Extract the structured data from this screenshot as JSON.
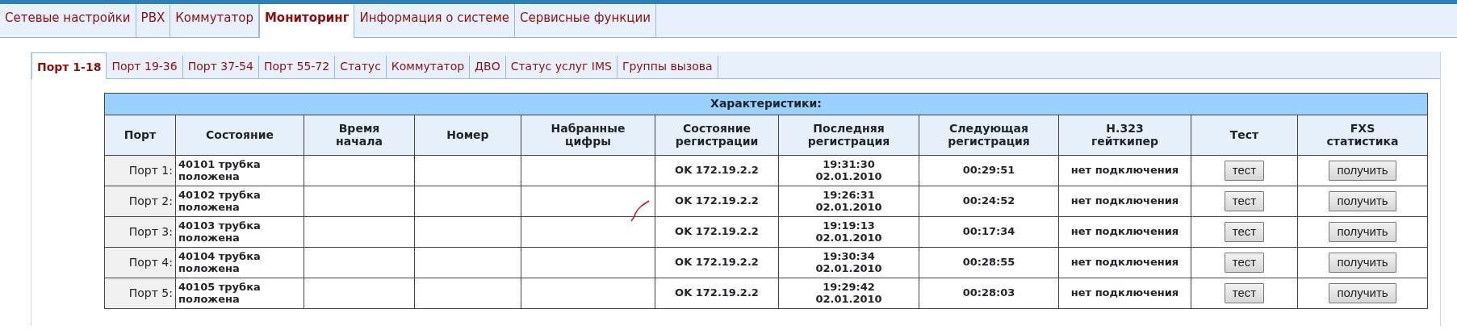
{
  "top_tabs": [
    {
      "label": "Сетевые настройки",
      "selected": false
    },
    {
      "label": "PBX",
      "selected": false
    },
    {
      "label": "Коммутатор",
      "selected": false
    },
    {
      "label": "Мониторинг",
      "selected": true
    },
    {
      "label": "Информация о системе",
      "selected": false
    },
    {
      "label": "Сервисные функции",
      "selected": false
    }
  ],
  "sub_tabs": [
    {
      "label": "Порт 1-18",
      "selected": true
    },
    {
      "label": "Порт 19-36",
      "selected": false
    },
    {
      "label": "Порт 37-54",
      "selected": false
    },
    {
      "label": "Порт 55-72",
      "selected": false
    },
    {
      "label": "Статус",
      "selected": false
    },
    {
      "label": "Коммутатор",
      "selected": false
    },
    {
      "label": "ДВО",
      "selected": false
    },
    {
      "label": "Статус услуг IMS",
      "selected": false
    },
    {
      "label": "Группы вызова",
      "selected": false
    }
  ],
  "table": {
    "title": "Характеристики:",
    "columns": [
      "Порт",
      "Состояние",
      "Время\nначала",
      "Номер",
      "Набранные\nцифры",
      "Состояние\nрегистрации",
      "Последняя\nрегистрация",
      "Следующая\nрегистрация",
      "H.323\nгейткипер",
      "Тест",
      "FXS\nстатистика"
    ],
    "rows": [
      {
        "port": "Порт 1:",
        "state": "40101 трубка\nположена",
        "reg_state": "OK 172.19.2.2",
        "last_reg": "19:31:30\n02.01.2010",
        "next_reg": "00:29:51",
        "gatekeeper": "нет подключения",
        "test_button": "тест",
        "stats_button": "получить"
      },
      {
        "port": "Порт 2:",
        "state": "40102 трубка\nположена",
        "reg_state": "OK 172.19.2.2",
        "last_reg": "19:26:31\n02.01.2010",
        "next_reg": "00:24:52",
        "gatekeeper": "нет подключения",
        "test_button": "тест",
        "stats_button": "получить"
      },
      {
        "port": "Порт 3:",
        "state": "40103 трубка\nположена",
        "reg_state": "OK 172.19.2.2",
        "last_reg": "19:19:13\n02.01.2010",
        "next_reg": "00:17:34",
        "gatekeeper": "нет подключения",
        "test_button": "тест",
        "stats_button": "получить"
      },
      {
        "port": "Порт 4:",
        "state": "40104 трубка\nположена",
        "reg_state": "OK 172.19.2.2",
        "last_reg": "19:30:34\n02.01.2010",
        "next_reg": "00:28:55",
        "gatekeeper": "нет подключения",
        "test_button": "тест",
        "stats_button": "получить"
      },
      {
        "port": "Порт 5:",
        "state": "40105 трубка\nположена",
        "reg_state": "OK 172.19.2.2",
        "last_reg": "19:29:42\n02.01.2010",
        "next_reg": "00:28:03",
        "gatekeeper": "нет подключения",
        "test_button": "тест",
        "stats_button": "получить"
      }
    ]
  }
}
